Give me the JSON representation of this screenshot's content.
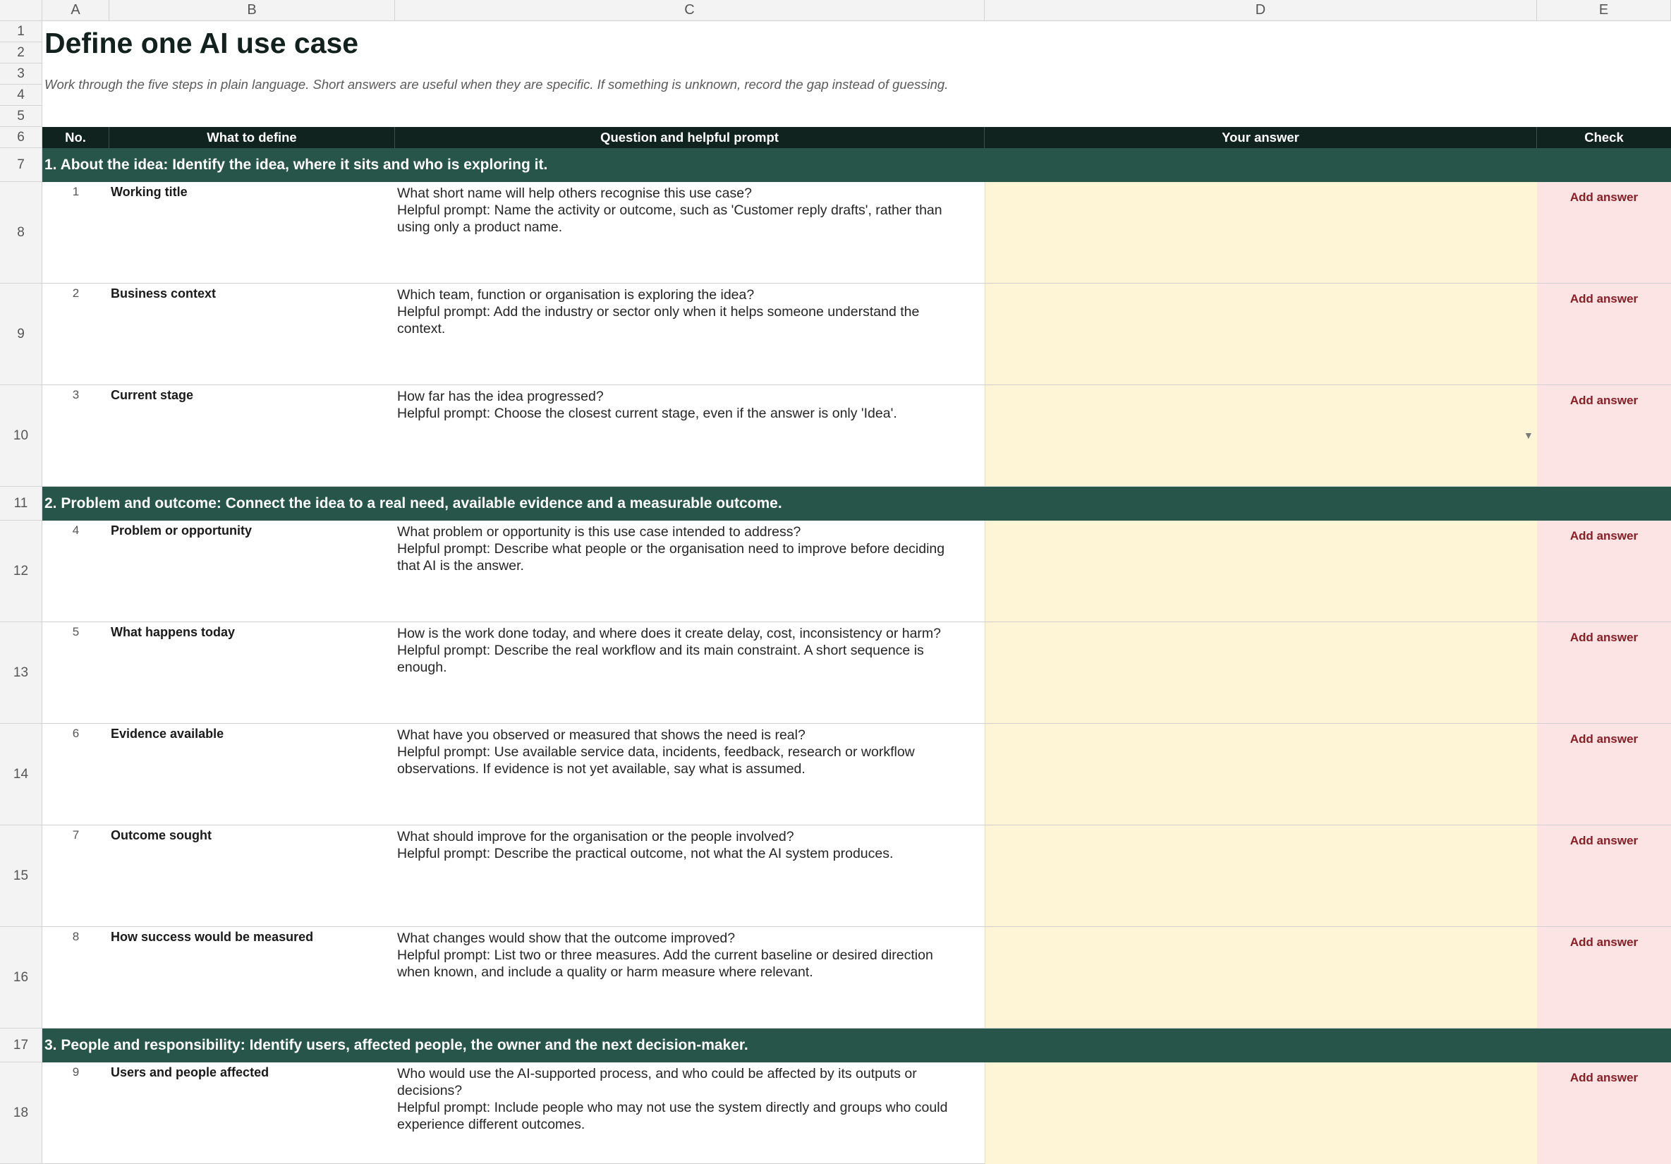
{
  "columns": [
    "A",
    "B",
    "C",
    "D",
    "E"
  ],
  "row_numbers": [
    "1",
    "2",
    "3",
    "4",
    "5",
    "6",
    "7",
    "8",
    "9",
    "10",
    "11",
    "12",
    "13",
    "14",
    "15",
    "16",
    "17",
    "18"
  ],
  "title": "Define one AI use case",
  "subtitle": "Work through the five steps in plain language. Short answers are useful when they are specific. If something is unknown, record the gap instead of guessing.",
  "table_header": {
    "no": "No.",
    "what": "What to define",
    "question": "Question and helpful prompt",
    "answer": "Your answer",
    "check": "Check"
  },
  "sections": [
    "1. About the idea: Identify the idea, where it sits and who is exploring it.",
    "2. Problem and outcome: Connect the idea to a real need, available evidence and a measurable outcome.",
    "3. People and responsibility: Identify users, affected people, the owner and the next decision-maker."
  ],
  "items": [
    {
      "no": "1",
      "label": "Working title",
      "question": "What short name will help others recognise this use case?",
      "prompt": "Helpful prompt: Name the activity or outcome, such as 'Customer reply drafts', rather than using only a product name.",
      "answer": "",
      "check": "Add answer"
    },
    {
      "no": "2",
      "label": "Business context",
      "question": "Which team, function or organisation is exploring the idea?",
      "prompt": "Helpful prompt: Add the industry or sector only when it helps someone understand the context.",
      "answer": "",
      "check": "Add answer"
    },
    {
      "no": "3",
      "label": "Current stage",
      "question": "How far has the idea progressed?",
      "prompt": "Helpful prompt: Choose the closest current stage, even if the answer is only 'Idea'.",
      "answer": "",
      "check": "Add answer"
    },
    {
      "no": "4",
      "label": "Problem or opportunity",
      "question": "What problem or opportunity is this use case intended to address?",
      "prompt": "Helpful prompt: Describe what people or the organisation need to improve before deciding that AI is the answer.",
      "answer": "",
      "check": "Add answer"
    },
    {
      "no": "5",
      "label": "What happens today",
      "question": "How is the work done today, and where does it create delay, cost, inconsistency or harm?",
      "prompt": "Helpful prompt: Describe the real workflow and its main constraint. A short sequence is enough.",
      "answer": "",
      "check": "Add answer"
    },
    {
      "no": "6",
      "label": "Evidence available",
      "question": "What have you observed or measured that shows the need is real?",
      "prompt": "Helpful prompt: Use available service data, incidents, feedback, research or workflow observations. If evidence is not yet available, say what is assumed.",
      "answer": "",
      "check": "Add answer"
    },
    {
      "no": "7",
      "label": "Outcome sought",
      "question": "What should improve for the organisation or the people involved?",
      "prompt": "Helpful prompt: Describe the practical outcome, not what the AI system produces.",
      "answer": "",
      "check": "Add answer"
    },
    {
      "no": "8",
      "label": "How success would be measured",
      "question": "What changes would show that the outcome improved?",
      "prompt": "Helpful prompt: List two or three measures. Add the current baseline or desired direction when known, and include a quality or harm measure where relevant.",
      "answer": "",
      "check": "Add answer"
    },
    {
      "no": "9",
      "label": "Users and people affected",
      "question": "Who would use the AI-supported process, and who could be affected by its outputs or decisions?",
      "prompt": "Helpful prompt: Include people who may not use the system directly and groups who could experience different outcomes.",
      "answer": "",
      "check": "Add answer"
    }
  ],
  "colors": {
    "header_bg": "#11231e",
    "section_bg": "#27554a",
    "answer_bg": "#fef5d6",
    "check_bg": "#fce4e5",
    "check_text": "#8b1d25"
  },
  "icons": {
    "dropdown": "chevron-down-icon"
  }
}
